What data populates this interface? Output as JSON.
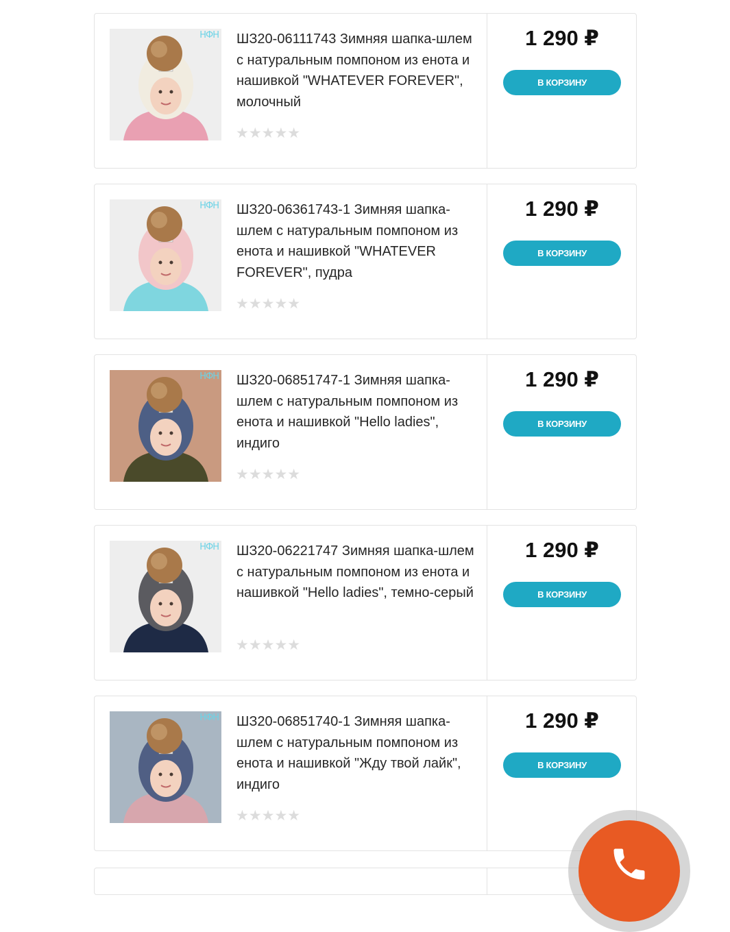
{
  "colors": {
    "accent": "#1fa9c4",
    "call_button": "#e85a23"
  },
  "products": [
    {
      "title": "ШЗ20-06111743 Зимняя шапка-шлем с натуральным помпоном из енота и нашивкой \"WHATEVER FOREVER\", молочный",
      "price": "1 290 ₽",
      "button": "В корзину",
      "stars": "★★★★★",
      "brand": "НФН",
      "hat_color": "#f1ece0",
      "coat_color": "#e9a0b2",
      "bg_color": "#eeeeee"
    },
    {
      "title": "ШЗ20-06361743-1 Зимняя шапка-шлем с натуральным помпоном из енота и нашивкой \"WHATEVER FOREVER\", пудра",
      "price": "1 290 ₽",
      "button": "В корзину",
      "stars": "★★★★★",
      "brand": "НФН",
      "hat_color": "#f2c6c9",
      "coat_color": "#7fd6df",
      "bg_color": "#eeeeee"
    },
    {
      "title": "ШЗ20-06851747-1 Зимняя шапка-шлем с натуральным помпоном из енота и нашивкой \"Hello ladies\", индиго",
      "price": "1 290 ₽",
      "button": "В корзину",
      "stars": "★★★★★",
      "brand": "НФН",
      "hat_color": "#4d5f85",
      "coat_color": "#4a4a2a",
      "bg_color": "#c99a80"
    },
    {
      "title": "ШЗ20-06221747 Зимняя шапка-шлем с натуральным помпоном из енота и нашивкой \"Hello ladies\", темно-серый",
      "price": "1 290 ₽",
      "button": "В корзину",
      "stars": "★★★★★",
      "brand": "НФН",
      "hat_color": "#5b5b60",
      "coat_color": "#1e2a45",
      "bg_color": "#eeeeee"
    },
    {
      "title": "ШЗ20-06851740-1 Зимняя шапка-шлем с натуральным помпоном из енота и нашивкой \"Жду твой лайк\", индиго",
      "price": "1 290 ₽",
      "button": "В корзину",
      "stars": "★★★★★",
      "brand": "НФН",
      "hat_color": "#505f84",
      "coat_color": "#d7a6ad",
      "bg_color": "#a9b6c2"
    }
  ],
  "call_button": {
    "icon": "phone-icon"
  }
}
